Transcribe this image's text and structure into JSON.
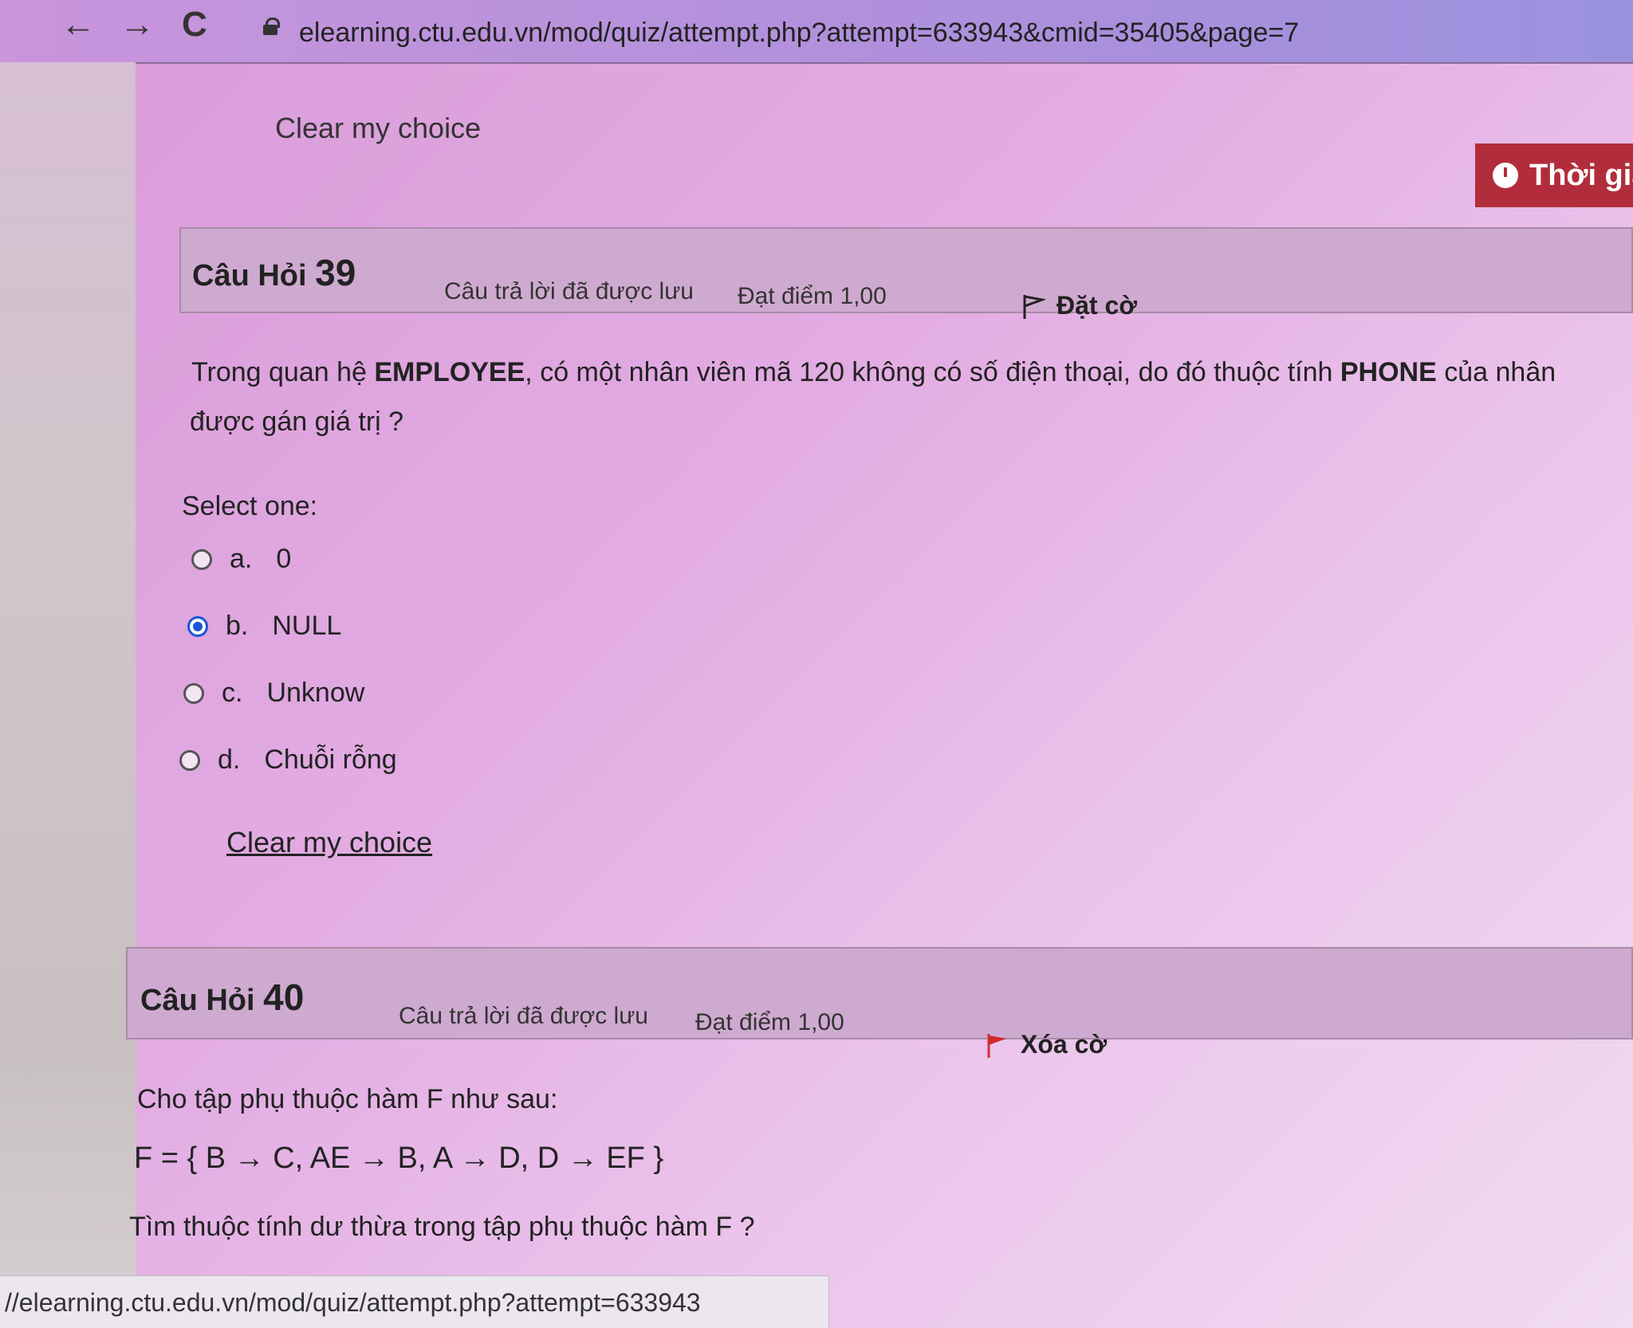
{
  "browser": {
    "back": "←",
    "forward": "→",
    "reload": "C",
    "url": "elearning.ctu.edu.vn/mod/quiz/attempt.php?attempt=633943&cmid=35405&page=7"
  },
  "top": {
    "clear_choice": "Clear my choice",
    "timer_label": "Thời gia"
  },
  "q39": {
    "label": "Câu Hỏi",
    "number": "39",
    "status": "Câu trả lời đã được lưu",
    "grade": "Đạt điểm 1,00",
    "flag_label": "Đặt cờ",
    "text_line1_a": "Trong quan hệ ",
    "text_line1_b": "EMPLOYEE",
    "text_line1_c": ", có một nhân viên mã 120 không có số điện thoại, do đó thuộc tính ",
    "text_line1_d": "PHONE",
    "text_line1_e": " của nhân",
    "text_line2": "được gán giá trị ?",
    "select_one": "Select one:",
    "options": [
      {
        "letter": "a.",
        "text": "0",
        "checked": false
      },
      {
        "letter": "b.",
        "text": "NULL",
        "checked": true
      },
      {
        "letter": "c.",
        "text": "Unknow",
        "checked": false
      },
      {
        "letter": "d.",
        "text": "Chuỗi rỗng",
        "checked": false
      }
    ],
    "clear_choice": "Clear my choice"
  },
  "q40": {
    "label": "Câu Hỏi",
    "number": "40",
    "status": "Câu trả lời đã được lưu",
    "grade": "Đạt điểm 1,00",
    "flag_label": "Xóa cờ",
    "text_line1": "Cho tập phụ thuộc hàm F như sau:",
    "formula": "F = { B → C, AE → B, A → D, D → EF }",
    "text_line2": "Tìm thuộc tính dư thừa trong tập phụ thuộc hàm F ?"
  },
  "status_bar": {
    "url": "//elearning.ctu.edu.vn/mod/quiz/attempt.php?attempt=633943"
  },
  "colors": {
    "timer_bg": "#b22d3b",
    "radio_checked": "#1a56d6",
    "flag_red": "#d02a2a"
  }
}
